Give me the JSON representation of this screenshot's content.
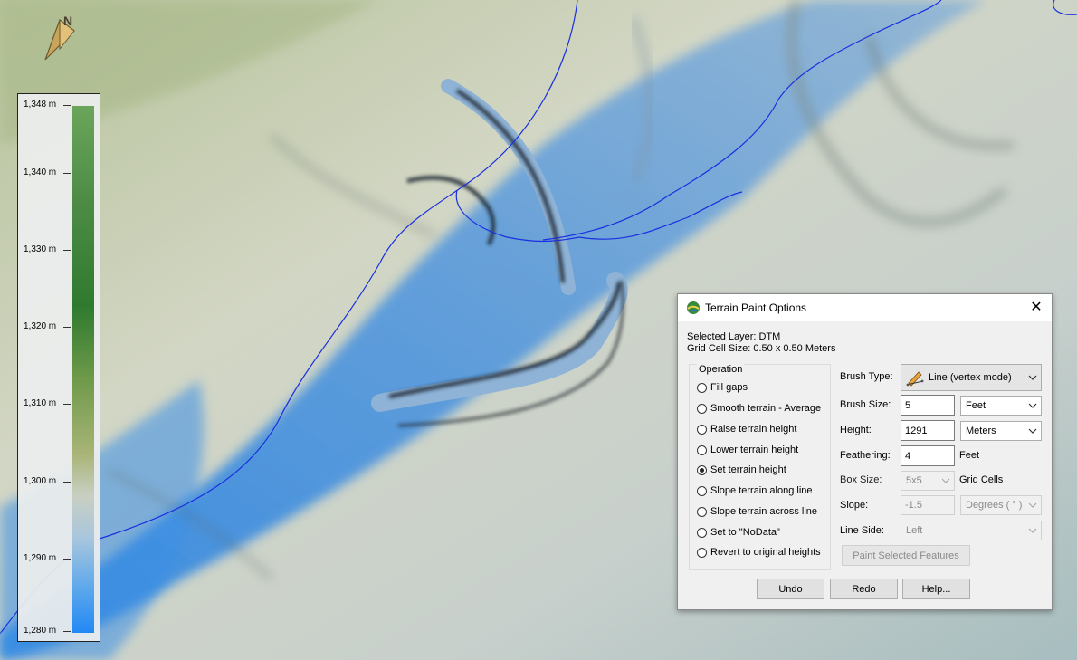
{
  "legend": {
    "ticks": [
      "1,348 m",
      "1,340 m",
      "1,330 m",
      "1,320 m",
      "1,310 m",
      "1,300 m",
      "1,290 m",
      "1,280 m"
    ]
  },
  "icons": {
    "north_arrow": "north-arrow-icon",
    "app": "globe-icon",
    "close": "close-icon",
    "brush": "pencil-line-icon",
    "dropdown": "chevron-down-icon"
  },
  "colors": {
    "water_line": "#1a2fe0",
    "terrain_low": "#2288f4",
    "terrain_high": "#4e8c46"
  },
  "dialog": {
    "title": "Terrain Paint Options",
    "close_glyph": "✕",
    "selected_layer": "Selected Layer: DTM",
    "grid_cell_size": "Grid Cell Size: 0.50 x 0.50 Meters",
    "operation": {
      "label": "Operation",
      "options": [
        "Fill gaps",
        "Smooth terrain - Average",
        "Raise terrain height",
        "Lower terrain height",
        "Set terrain height",
        "Slope terrain along line",
        "Slope terrain across line",
        "Set to \"NoData\"",
        "Revert to original heights"
      ],
      "selected": "Set terrain height"
    },
    "brush_type": {
      "label": "Brush Type:",
      "value": "Line (vertex mode)"
    },
    "brush_size": {
      "label": "Brush Size:",
      "value": "5",
      "unit": "Feet"
    },
    "height": {
      "label": "Height:",
      "value": "1291",
      "unit": "Meters"
    },
    "feathering": {
      "label": "Feathering:",
      "value": "4",
      "unit": "Feet"
    },
    "box_size": {
      "label": "Box Size:",
      "value": "5x5",
      "unit": "Grid Cells"
    },
    "slope": {
      "label": "Slope:",
      "value": "-1.5",
      "unit": "Degrees ( ° )"
    },
    "line_side": {
      "label": "Line Side:",
      "value": "Left"
    },
    "paint_button": "Paint Selected Features",
    "undo_button": "Undo",
    "redo_button": "Redo",
    "help_button": "Help..."
  }
}
